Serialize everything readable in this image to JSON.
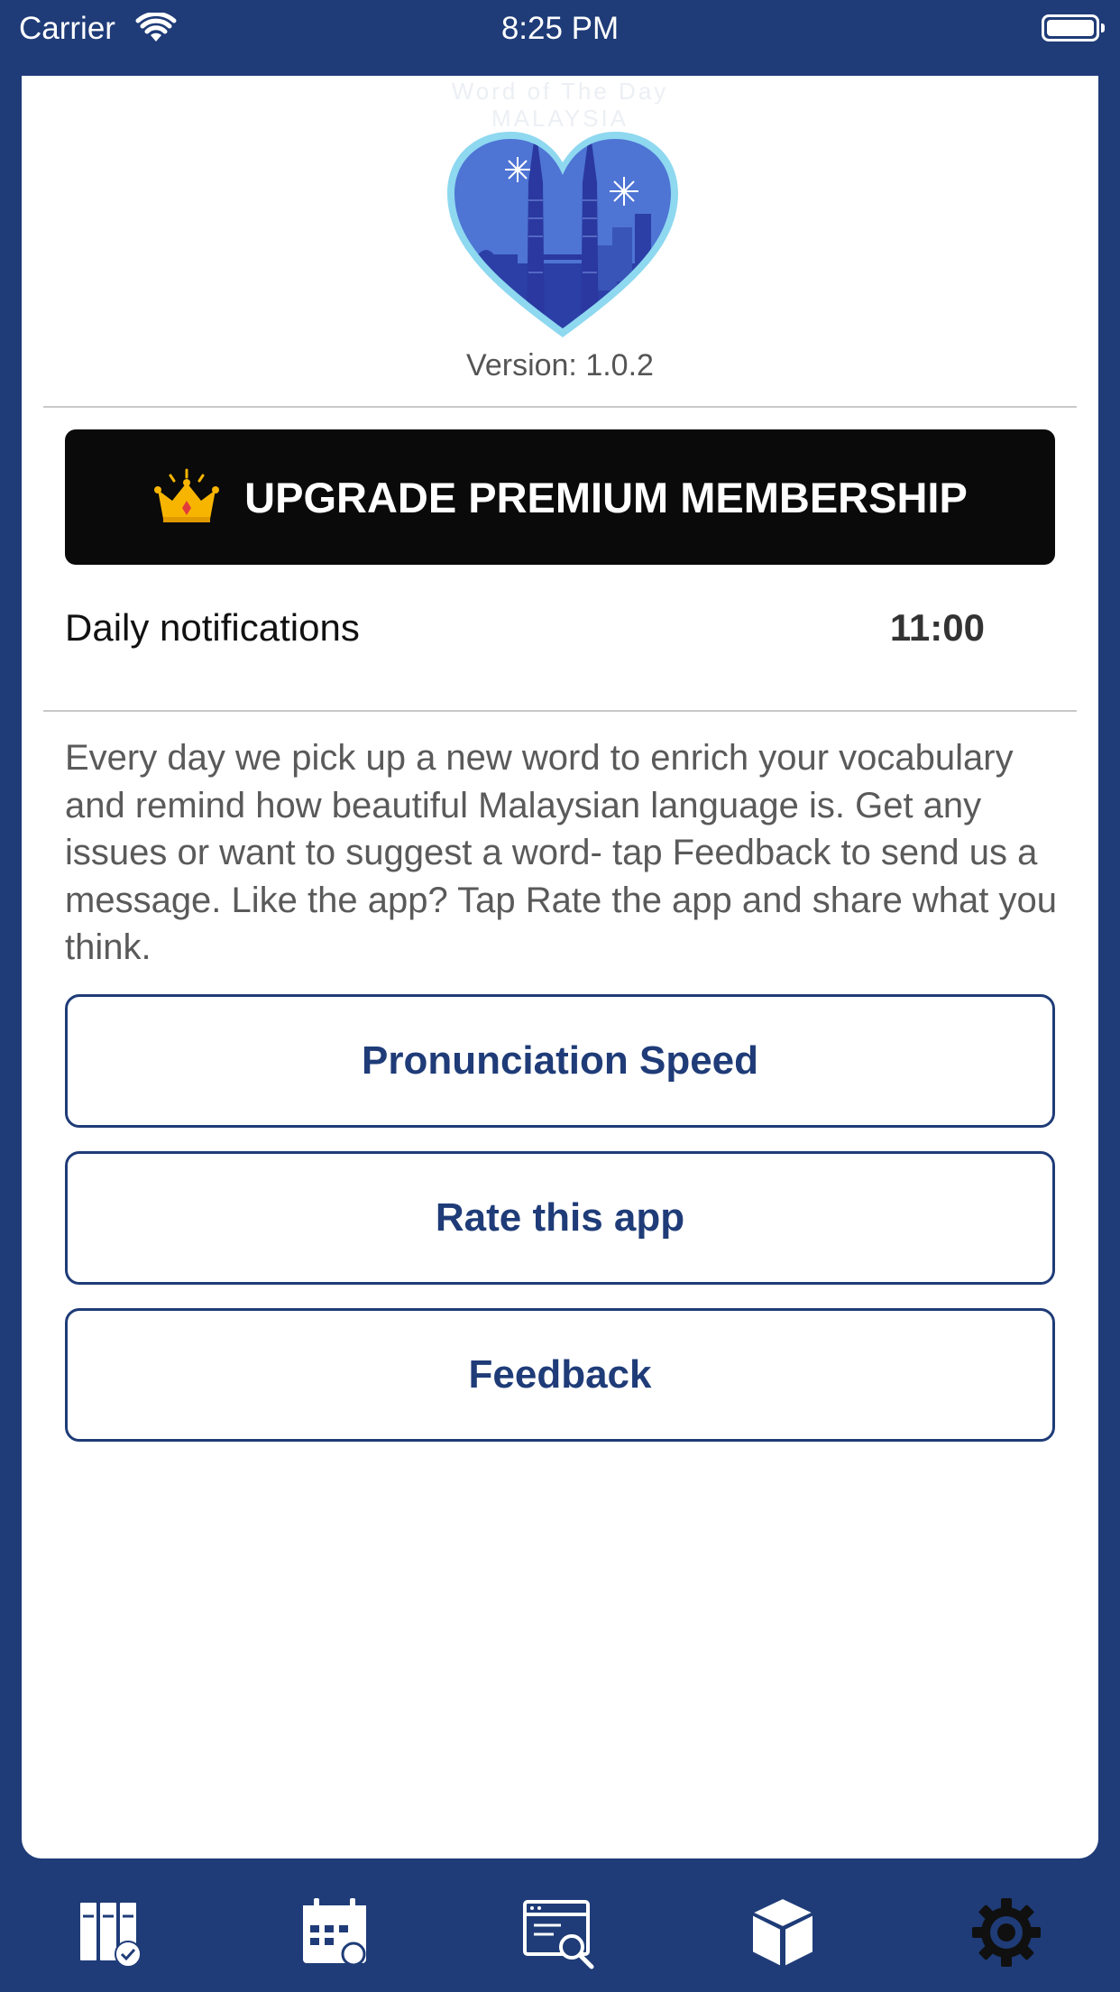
{
  "status_bar": {
    "carrier": "Carrier",
    "time": "8:25 PM"
  },
  "header": {
    "app_name_line1": "Word of The Day",
    "app_name_line2": "MALAYSIA",
    "version": "Version: 1.0.2"
  },
  "premium": {
    "label": "UPGRADE PREMIUM MEMBERSHIP",
    "icon": "crown-icon"
  },
  "notifications": {
    "label": "Daily notifications",
    "time": "11:00"
  },
  "description": "Every day we pick up a new word to enrich your vocabulary and remind how  beautiful Malaysian language is. Get any issues or want to suggest a word- tap Feedback to send us a message. Like the app? Tap Rate the app and share what you think.",
  "buttons": {
    "pronunciation_speed": "Pronunciation Speed",
    "rate_app": "Rate this app",
    "feedback": "Feedback"
  },
  "tab_bar": {
    "items": [
      {
        "icon": "books-check-icon"
      },
      {
        "icon": "calendar-icon"
      },
      {
        "icon": "search-window-icon"
      },
      {
        "icon": "abc-cube-icon"
      },
      {
        "icon": "settings-gear-icon"
      }
    ]
  },
  "colors": {
    "brand": "#1f3c78",
    "premium_bg": "#0a0a0a",
    "card": "#ffffff"
  }
}
